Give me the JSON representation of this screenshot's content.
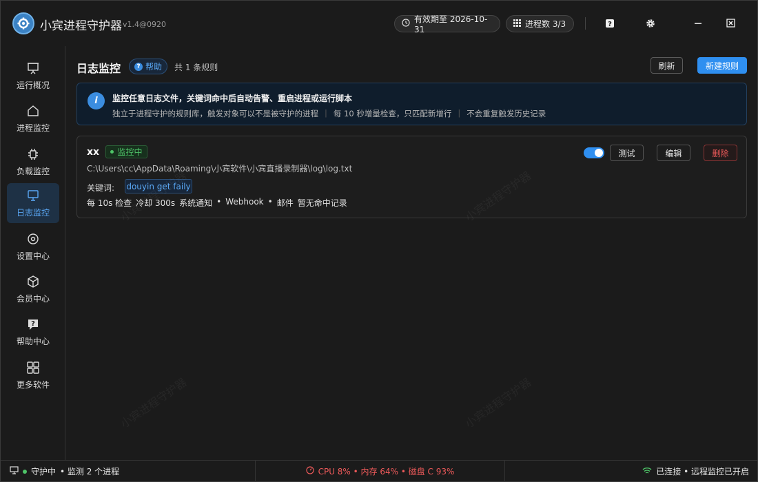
{
  "app": {
    "title": "小宾进程守护器",
    "version": "v1.4@0920",
    "expiry": "有效期至 2026-10-31",
    "process_count": "进程数 3/3"
  },
  "sidebar": {
    "items": [
      {
        "label": "运行概况",
        "icon": "presentation-icon",
        "active": false
      },
      {
        "label": "进程监控",
        "icon": "home-icon",
        "active": false
      },
      {
        "label": "负载监控",
        "icon": "cpu-icon",
        "active": false
      },
      {
        "label": "日志监控",
        "icon": "monitor-icon",
        "active": true
      },
      {
        "label": "设置中心",
        "icon": "settings-icon",
        "active": false
      },
      {
        "label": "会员中心",
        "icon": "box-icon",
        "active": false
      },
      {
        "label": "帮助中心",
        "icon": "help-icon",
        "active": false
      },
      {
        "label": "更多软件",
        "icon": "grid-icon",
        "active": false
      }
    ]
  },
  "main": {
    "title": "日志监控",
    "help_label": "帮助",
    "rule_count": "共 1 条规则",
    "refresh_label": "刷新",
    "new_rule_label": "新建规则",
    "banner": {
      "title": "监控任意日志文件，关键词命中后自动告警、重启进程或运行脚本",
      "notes": [
        "独立于进程守护的规则库，触发对象可以不是被守护的进程",
        "每 10 秒增量检查，只匹配新增行",
        "不会重复触发历史记录"
      ]
    },
    "rules": [
      {
        "name": "xx",
        "status": "监控中",
        "path": "C:\\Users\\cc\\AppData\\Roaming\\小宾软件\\小宾直播录制器\\log\\log.txt",
        "keyword_label": "关键词:",
        "keyword": "douyin get faily",
        "meta": [
          "每 10s 检查",
          "冷却 300s",
          "系统通知",
          "•",
          "Webhook",
          "•",
          "邮件",
          "暂无命中记录"
        ],
        "enabled": true,
        "test_label": "测试",
        "edit_label": "编辑",
        "delete_label": "删除"
      }
    ],
    "watermark": "小宾进程守护器"
  },
  "statusbar": {
    "guard": "守护中",
    "monitoring": "• 监测 2 个进程",
    "resources": "CPU 8%  •  内存 64%  •  磁盘 C 93%",
    "connection": "已连接 • 远程监控已开启"
  },
  "colors": {
    "accent": "#2f8ff0",
    "success": "#4ec468",
    "danger": "#ef5a5a"
  }
}
